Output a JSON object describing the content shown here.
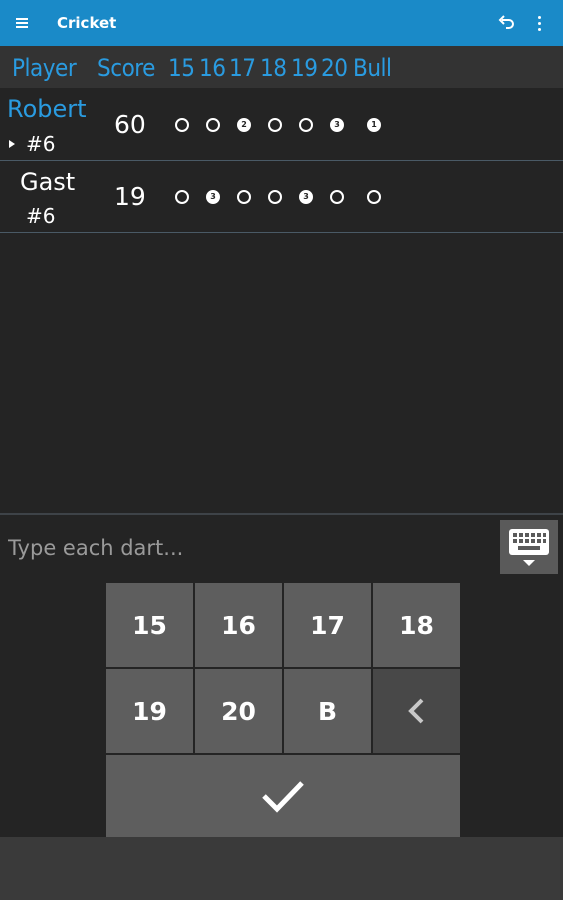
{
  "appbar": {
    "title": "Cricket",
    "undo_icon": "undo-icon",
    "more_icon": "more-vert-icon",
    "menu_icon": "menu-icon"
  },
  "header": {
    "player": "Player",
    "score": "Score",
    "targets": [
      "15",
      "16",
      "17",
      "18",
      "19",
      "20",
      "Bull"
    ]
  },
  "players": [
    {
      "name": "Robert",
      "number": "#6",
      "score": "60",
      "active": true,
      "name_color": "#2a9be0",
      "marks": [
        "",
        "",
        "2",
        "",
        "",
        "3",
        "1"
      ]
    },
    {
      "name": "Gast",
      "number": "#6",
      "score": "19",
      "active": false,
      "name_color": "#ffffff",
      "marks": [
        "",
        "3",
        "",
        "",
        "3",
        "",
        ""
      ]
    }
  ],
  "input": {
    "placeholder": "Type each dart..."
  },
  "keypad": {
    "keys": [
      "15",
      "16",
      "17",
      "18",
      "19",
      "20",
      "B"
    ],
    "backspace_icon": "chevron-left-icon",
    "confirm_icon": "check-icon"
  },
  "colors": {
    "accent": "#1a8ac8",
    "background": "#242424",
    "key": "#5e5e5e"
  }
}
